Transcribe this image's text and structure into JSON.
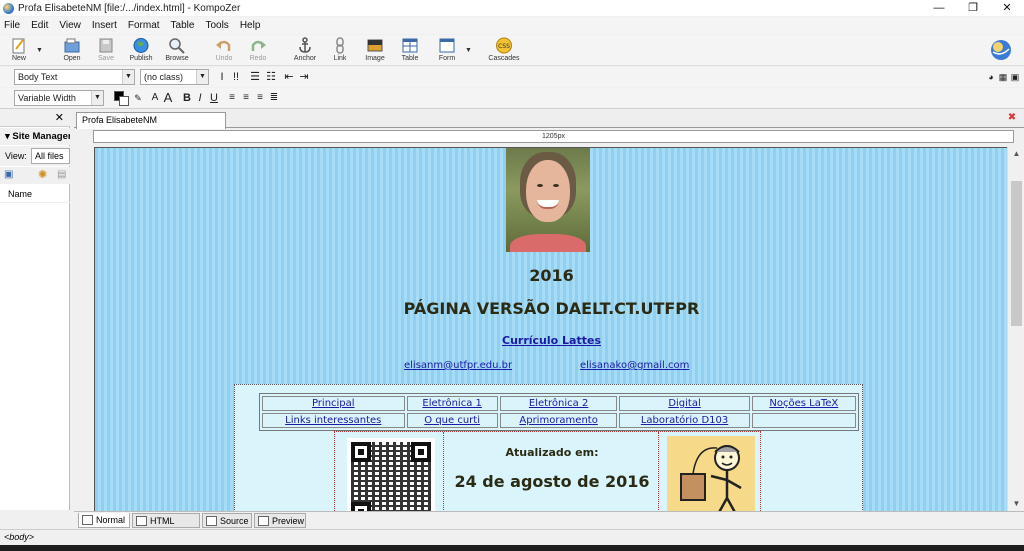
{
  "window": {
    "title": "Profa ElisabeteNM [file:/.../index.html] - KompoZer",
    "controls": [
      "—",
      "❐",
      "✕"
    ]
  },
  "menu": [
    "File",
    "Edit",
    "View",
    "Insert",
    "Format",
    "Table",
    "Tools",
    "Help"
  ],
  "toolbar": {
    "new": "New",
    "open": "Open",
    "save": "Save",
    "publish": "Publish",
    "browse": "Browse",
    "undo": "Undo",
    "redo": "Redo",
    "anchor": "Anchor",
    "link": "Link",
    "image": "Image",
    "table": "Table",
    "form": "Form",
    "cascades": "Cascades"
  },
  "format": {
    "paragraph_style": "Body Text",
    "class": "(no class)",
    "font": "Variable Width"
  },
  "sidebar": {
    "title": "Site Manager",
    "view_label": "View:",
    "view_value": "All files",
    "column_name": "Name"
  },
  "editor": {
    "tab_label": "Profa ElisabeteNM",
    "ruler_label": "1205px"
  },
  "page": {
    "year": "2016",
    "heading": "PÁGINA VERSÃO DAELT.CT.UTFPR",
    "cv_link": "Currículo Lattes",
    "email1": "elisanm@utfpr.edu.br",
    "email2": "elisanako@gmail.com",
    "nav_rows": [
      [
        "Principal",
        "Eletrônica 1",
        "Eletrônica 2",
        "Digital",
        "Noções LaTeX"
      ],
      [
        "Links interessantes",
        "O que curti",
        "Aprimoramento",
        "Laboratório D103",
        ""
      ]
    ],
    "updated_label": "Atualizado em:",
    "updated_date": "24 de agosto de 2016"
  },
  "bottom_tabs": [
    "Normal",
    "HTML Tags",
    "Source",
    "Preview"
  ],
  "status": "<body>",
  "colors": {
    "page_stripe_a": "#8fd0f2",
    "page_stripe_b": "#a6dcf6",
    "link": "#1a1aa6",
    "heading": "#2b2b14"
  }
}
